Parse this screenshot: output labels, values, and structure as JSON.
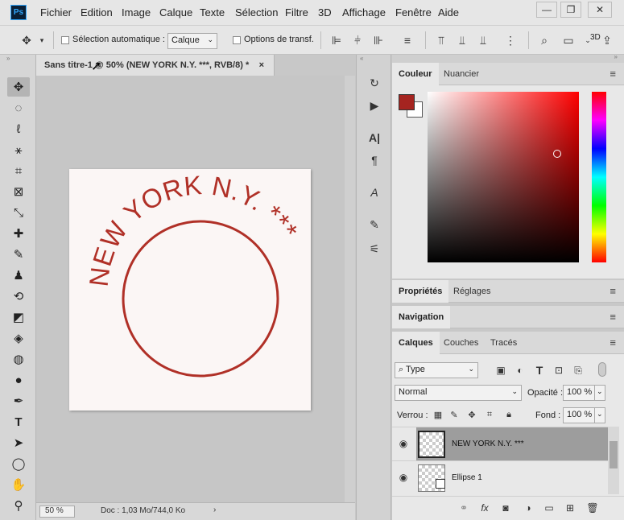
{
  "app": {
    "logo": "Ps"
  },
  "menu": [
    "Fichier",
    "Edition",
    "Image",
    "Calque",
    "Texte",
    "Sélection",
    "Filtre",
    "3D",
    "Affichage",
    "Fenêtre",
    "Aide"
  ],
  "window_buttons": [
    "—",
    "❐",
    "✕"
  ],
  "options": {
    "auto_select_label": "Sélection automatique :",
    "auto_select_value": "Calque",
    "transform_label": "Options de transf.",
    "more_label": "3D"
  },
  "document": {
    "tab_title": "Sans titre-1 @ 50% (NEW YORK N.Y. ***, RVB/8) *",
    "close": "×",
    "zoom": "50 %",
    "doc_size": "Doc : 1,03 Mo/744,0 Ko",
    "arrow": "›",
    "artwork_text": "NEW YORK N.Y. ***",
    "artwork_color": "#b03027"
  },
  "color_panel": {
    "tabs": [
      "Couleur",
      "Nuancier"
    ],
    "foreground": "#a52420",
    "background": "#ffffff"
  },
  "props_panel": {
    "tabs": [
      "Propriétés",
      "Réglages"
    ]
  },
  "nav_panel": {
    "tabs": [
      "Navigation"
    ]
  },
  "layers_panel": {
    "tabs": [
      "Calques",
      "Couches",
      "Tracés"
    ],
    "filter_label": "Type",
    "blend_mode": "Normal",
    "opacity_label": "Opacité :",
    "opacity": "100 %",
    "lock_label": "Verrou :",
    "fill_label": "Fond :",
    "fill": "100 %",
    "layers": [
      {
        "name": "NEW YORK N.Y. ***",
        "selected": true
      },
      {
        "name": "Ellipse 1",
        "selected": false
      }
    ]
  },
  "icons": [
    "move-icon",
    "marquee-icon",
    "lasso-icon",
    "magic-wand-icon",
    "crop-icon",
    "frame-icon",
    "eyedropper-icon",
    "healing-icon",
    "brush-icon",
    "stamp-icon",
    "history-brush-icon",
    "eraser-icon",
    "bucket-icon",
    "blur-icon",
    "dodge-icon",
    "pen-icon",
    "type-icon",
    "path-select-icon",
    "ellipse-icon",
    "hand-icon",
    "zoom-icon"
  ]
}
